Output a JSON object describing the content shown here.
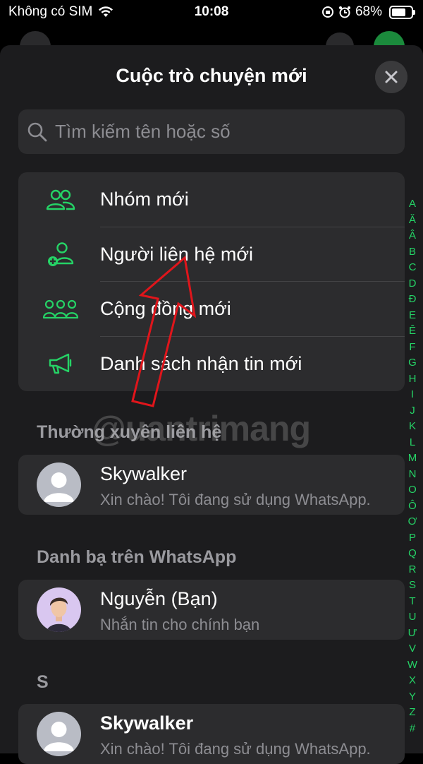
{
  "status_bar": {
    "carrier": "Không có SIM",
    "time": "10:08",
    "battery": "68%"
  },
  "sheet": {
    "title": "Cuộc trò chuyện mới",
    "close_icon": "close-icon"
  },
  "search": {
    "placeholder": "Tìm kiếm tên hoặc số"
  },
  "menu": [
    {
      "label": "Nhóm mới",
      "icon": "group-icon"
    },
    {
      "label": "Người liên hệ mới",
      "icon": "add-contact-icon"
    },
    {
      "label": "Cộng đồng mới",
      "icon": "community-icon"
    },
    {
      "label": "Danh sách nhận tin mới",
      "icon": "broadcast-icon"
    }
  ],
  "sections": {
    "frequent": "Thường xuyên liên hệ",
    "whatsapp": "Danh bạ trên WhatsApp",
    "s": "S"
  },
  "frequent_contact": {
    "name": "Skywalker",
    "status": "Xin chào! Tôi đang sử dụng WhatsApp."
  },
  "self_contact": {
    "name": "Nguyễn (Bạn)",
    "status": "Nhắn tin cho chính bạn"
  },
  "s_contact": {
    "name": "Skywalker",
    "status": "Xin chào! Tôi đang sử dụng WhatsApp."
  },
  "alpha_index": [
    "A",
    "Ă",
    "Â",
    "B",
    "C",
    "D",
    "Đ",
    "E",
    "Ê",
    "F",
    "G",
    "H",
    "I",
    "J",
    "K",
    "L",
    "M",
    "N",
    "O",
    "Ô",
    "Ơ",
    "P",
    "Q",
    "R",
    "S",
    "T",
    "U",
    "Ư",
    "V",
    "W",
    "X",
    "Y",
    "Z",
    "#"
  ],
  "watermark": "@uantrimang",
  "colors": {
    "accent": "#25d366",
    "sheet": "#1c1c1e",
    "card": "#2c2c2e",
    "annotation": "#e0151b"
  }
}
